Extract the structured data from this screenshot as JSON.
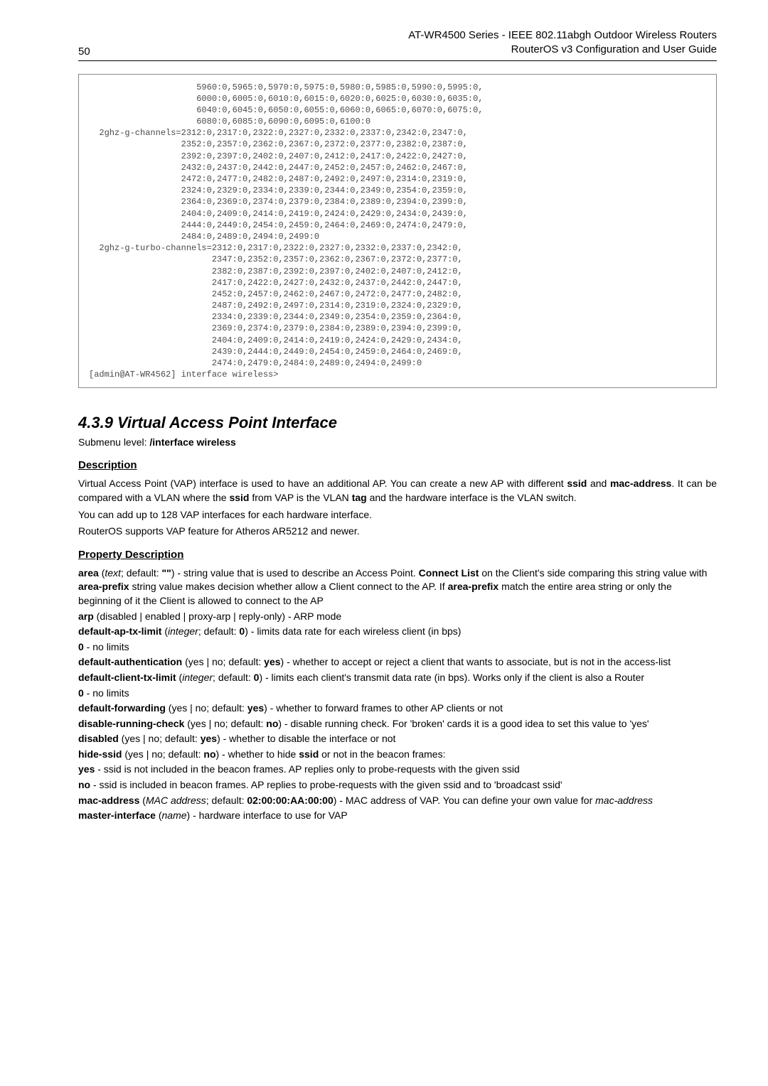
{
  "header": {
    "page_number": "50",
    "title_line1": "AT-WR4500 Series - IEEE 802.11abgh Outdoor Wireless Routers",
    "title_line2": "RouterOS v3 Configuration and User Guide"
  },
  "code": {
    "content": "                     5960:0,5965:0,5970:0,5975:0,5980:0,5985:0,5990:0,5995:0,\n                     6000:0,6005:0,6010:0,6015:0,6020:0,6025:0,6030:0,6035:0,\n                     6040:0,6045:0,6050:0,6055:0,6060:0,6065:0,6070:0,6075:0,\n                     6080:0,6085:0,6090:0,6095:0,6100:0\n  2ghz-g-channels=2312:0,2317:0,2322:0,2327:0,2332:0,2337:0,2342:0,2347:0,\n                  2352:0,2357:0,2362:0,2367:0,2372:0,2377:0,2382:0,2387:0,\n                  2392:0,2397:0,2402:0,2407:0,2412:0,2417:0,2422:0,2427:0,\n                  2432:0,2437:0,2442:0,2447:0,2452:0,2457:0,2462:0,2467:0,\n                  2472:0,2477:0,2482:0,2487:0,2492:0,2497:0,2314:0,2319:0,\n                  2324:0,2329:0,2334:0,2339:0,2344:0,2349:0,2354:0,2359:0,\n                  2364:0,2369:0,2374:0,2379:0,2384:0,2389:0,2394:0,2399:0,\n                  2404:0,2409:0,2414:0,2419:0,2424:0,2429:0,2434:0,2439:0,\n                  2444:0,2449:0,2454:0,2459:0,2464:0,2469:0,2474:0,2479:0,\n                  2484:0,2489:0,2494:0,2499:0\n  2ghz-g-turbo-channels=2312:0,2317:0,2322:0,2327:0,2332:0,2337:0,2342:0,\n                        2347:0,2352:0,2357:0,2362:0,2367:0,2372:0,2377:0,\n                        2382:0,2387:0,2392:0,2397:0,2402:0,2407:0,2412:0,\n                        2417:0,2422:0,2427:0,2432:0,2437:0,2442:0,2447:0,\n                        2452:0,2457:0,2462:0,2467:0,2472:0,2477:0,2482:0,\n                        2487:0,2492:0,2497:0,2314:0,2319:0,2324:0,2329:0,\n                        2334:0,2339:0,2344:0,2349:0,2354:0,2359:0,2364:0,\n                        2369:0,2374:0,2379:0,2384:0,2389:0,2394:0,2399:0,\n                        2404:0,2409:0,2414:0,2419:0,2424:0,2429:0,2434:0,\n                        2439:0,2444:0,2449:0,2454:0,2459:0,2464:0,2469:0,\n                        2474:0,2479:0,2484:0,2489:0,2494:0,2499:0\n[admin@AT-WR4562] interface wireless>"
  },
  "section": {
    "heading": "4.3.9 Virtual Access Point Interface",
    "submenu_prefix": "Submenu level: ",
    "submenu_path": "/interface wireless"
  },
  "description": {
    "heading": "Description",
    "para1_a": "Virtual Access Point (VAP) interface is used to have an additional AP. You can create a new AP with different ",
    "para1_b": "ssid",
    "para1_c": " and ",
    "para1_d": "mac-address",
    "para1_e": ". It can be compared with a VLAN where the ",
    "para1_f": "ssid",
    "para1_g": " from VAP is the VLAN ",
    "para1_h": "tag",
    "para1_i": " and the hardware interface is the VLAN switch.",
    "para2": "You can add up to 128 VAP interfaces for each hardware interface.",
    "para3": "RouterOS supports VAP feature for Atheros AR5212 and newer."
  },
  "props": {
    "heading": "Property Description",
    "area": {
      "name": "area",
      "type": "text",
      "def_label": "; default: ",
      "def": "\"\"",
      "desc_a": ") - string value that is used to describe an Access Point. ",
      "connect_list": "Connect List",
      "desc_b": " on the Client's side comparing this string value with ",
      "area_prefix1": "area-prefix",
      "desc_c": " string value makes decision whether allow a Client connect to the AP. If ",
      "area_prefix2": "area-prefix",
      "desc_d": " match the entire area string or only the beginning of it the Client is allowed to connect to the AP"
    },
    "arp": {
      "name": "arp",
      "val": " (disabled | enabled | proxy-arp | reply-only) - ARP mode"
    },
    "default_ap_tx": {
      "name": "default-ap-tx-limit",
      "type": "integer",
      "def": "0",
      "desc": ") - limits data rate for each wireless client (in bps)",
      "zero": "0",
      "zero_desc": " - no limits"
    },
    "default_auth": {
      "name": "default-authentication",
      "vals": " (yes | no; default: ",
      "def": "yes",
      "desc": ") - whether to accept or reject a client that wants to associate, but is not in the access-list"
    },
    "default_client_tx": {
      "name": "default-client-tx-limit",
      "type": "integer",
      "def": "0",
      "desc": ") - limits each client's transmit data rate (in bps). Works only if the client is also a Router",
      "zero": "0",
      "zero_desc": " - no limits"
    },
    "default_fwd": {
      "name": "default-forwarding",
      "vals": " (yes | no; default: ",
      "def": "yes",
      "desc": ") - whether to forward frames to other AP clients or not"
    },
    "disable_running": {
      "name": "disable-running-check",
      "vals": " (yes | no; default: ",
      "def": "no",
      "desc": ") - disable running check. For 'broken' cards it is a good idea to set this value to 'yes'"
    },
    "disabled": {
      "name": "disabled",
      "vals": " (yes | no; default: ",
      "def": "yes",
      "desc": ") - whether to disable the interface or not"
    },
    "hide_ssid": {
      "name": "hide-ssid",
      "vals": " (yes | no; default: ",
      "def": "no",
      "desc_a": ") - whether to hide ",
      "ssid": "ssid",
      "desc_b": " or not in the beacon frames:",
      "yes": "yes",
      "yes_desc": " - ssid is not included in the beacon frames. AP replies only to probe-requests with the given ssid",
      "no": "no",
      "no_desc": " - ssid is included in beacon frames. AP replies to probe-requests with the given ssid and to 'broadcast ssid'"
    },
    "mac_address": {
      "name": "mac-address",
      "type": "MAC address",
      "def": "02:00:00:AA:00:00",
      "desc": ") - MAC address of VAP. You can define your own value for ",
      "italic": "mac-address"
    },
    "master_interface": {
      "name": "master-interface",
      "type": "name",
      "desc": ") - hardware interface to use for VAP"
    }
  },
  "labels": {
    "open_paren": " (",
    "semicolon_default": "; default: "
  }
}
